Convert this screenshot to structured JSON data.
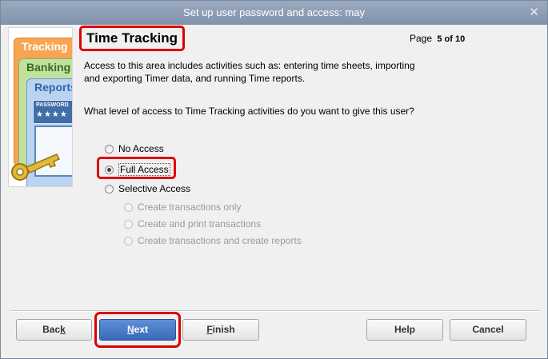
{
  "window": {
    "title": "Set up user password and access: may",
    "close_glyph": "✕"
  },
  "art": {
    "cards": [
      "Tracking",
      "Banking",
      "Reports"
    ],
    "password_label": "PASSWORD",
    "stars": "★★★★"
  },
  "header": {
    "title": "Time Tracking",
    "page_label": "Page",
    "page_value": "5 of 10"
  },
  "content": {
    "description": "Access to this area includes activities such as: entering time sheets, importing and exporting Timer data, and running Time reports.",
    "question": "What level of access to Time Tracking activities do you want to give this user?"
  },
  "options": {
    "no_access": "No Access",
    "full_access": "Full Access",
    "selective_access": "Selective Access",
    "selected": "Full Access",
    "sub": [
      "Create transactions only",
      "Create and print transactions",
      "Create transactions and create reports"
    ]
  },
  "buttons": {
    "back_pre": "Bac",
    "back_u": "k",
    "back_post": "",
    "next_pre": "",
    "next_u": "N",
    "next_post": "ext",
    "finish_pre": "",
    "finish_u": "F",
    "finish_post": "inish",
    "help": "Help",
    "cancel": "Cancel"
  },
  "colors": {
    "highlight": "#dd0000",
    "titlebar": "#8d9db3",
    "next_button": "#3a6ab8"
  }
}
